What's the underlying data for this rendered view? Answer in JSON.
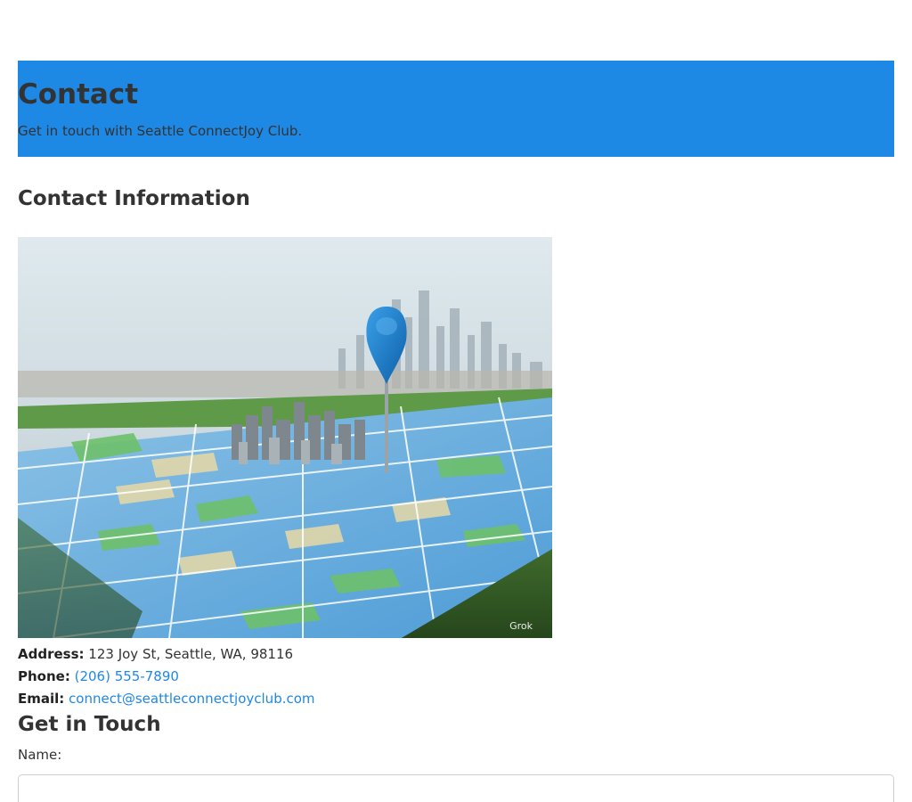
{
  "hero": {
    "title": "Contact",
    "subtitle": "Get in touch with Seattle ConnectJoy Club."
  },
  "contact_info": {
    "heading": "Contact Information",
    "image_icon": "map-pin-city-image",
    "watermark": "Grok",
    "address_label": "Address:",
    "address_value": "123 Joy St, Seattle, WA, 98116",
    "phone_label": "Phone:",
    "phone_value": "(206) 555-7890",
    "email_label": "Email:",
    "email_value": "connect@seattleconnectjoyclub.com"
  },
  "form": {
    "heading": "Get in Touch",
    "name_label": "Name:",
    "name_value": ""
  },
  "colors": {
    "accent": "#1e88e5",
    "text": "#333333",
    "background": "#ffffff"
  }
}
